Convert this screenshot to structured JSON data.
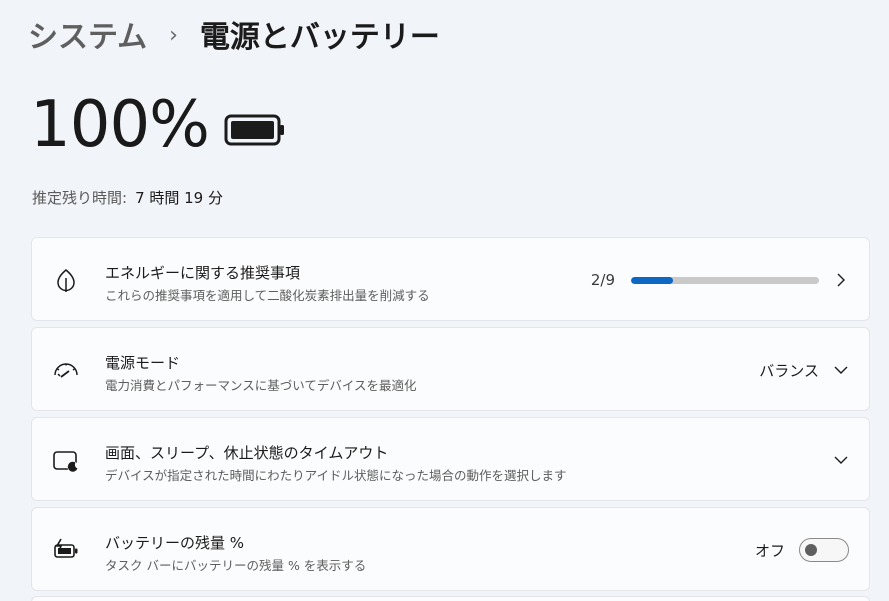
{
  "breadcrumb": {
    "parent": "システム",
    "separator": "›",
    "current": "電源とバッテリー"
  },
  "battery": {
    "percent_label": "100%",
    "level": 1.0,
    "remaining_label": "推定残り時間:",
    "remaining_value": "7 時間 19 分"
  },
  "cards": {
    "energy": {
      "icon": "leaf-icon",
      "title": "エネルギーに関する推奨事項",
      "desc": "これらの推奨事項を適用して二酸化炭素排出量を削減する",
      "progress_label": "2/9",
      "progress": 0.222
    },
    "power_mode": {
      "icon": "speedometer-icon",
      "title": "電源モード",
      "desc": "電力消費とパフォーマンスに基づいてデバイスを最適化",
      "value": "バランス"
    },
    "sleep": {
      "icon": "screen-sleep-icon",
      "title": "画面、スリープ、休止状態のタイムアウト",
      "desc": "デバイスが指定された時間にわたりアイドル状態になった場合の動作を選択します"
    },
    "battery_pct": {
      "icon": "battery-charging-icon",
      "title": "バッテリーの残量 %",
      "desc": "タスク バーにバッテリーの残量 % を表示する",
      "toggle_label": "オフ",
      "toggle_on": false
    }
  },
  "colors": {
    "accent": "#0f67c4",
    "background": "#f1f4f9",
    "card": "#fbfcfd"
  }
}
